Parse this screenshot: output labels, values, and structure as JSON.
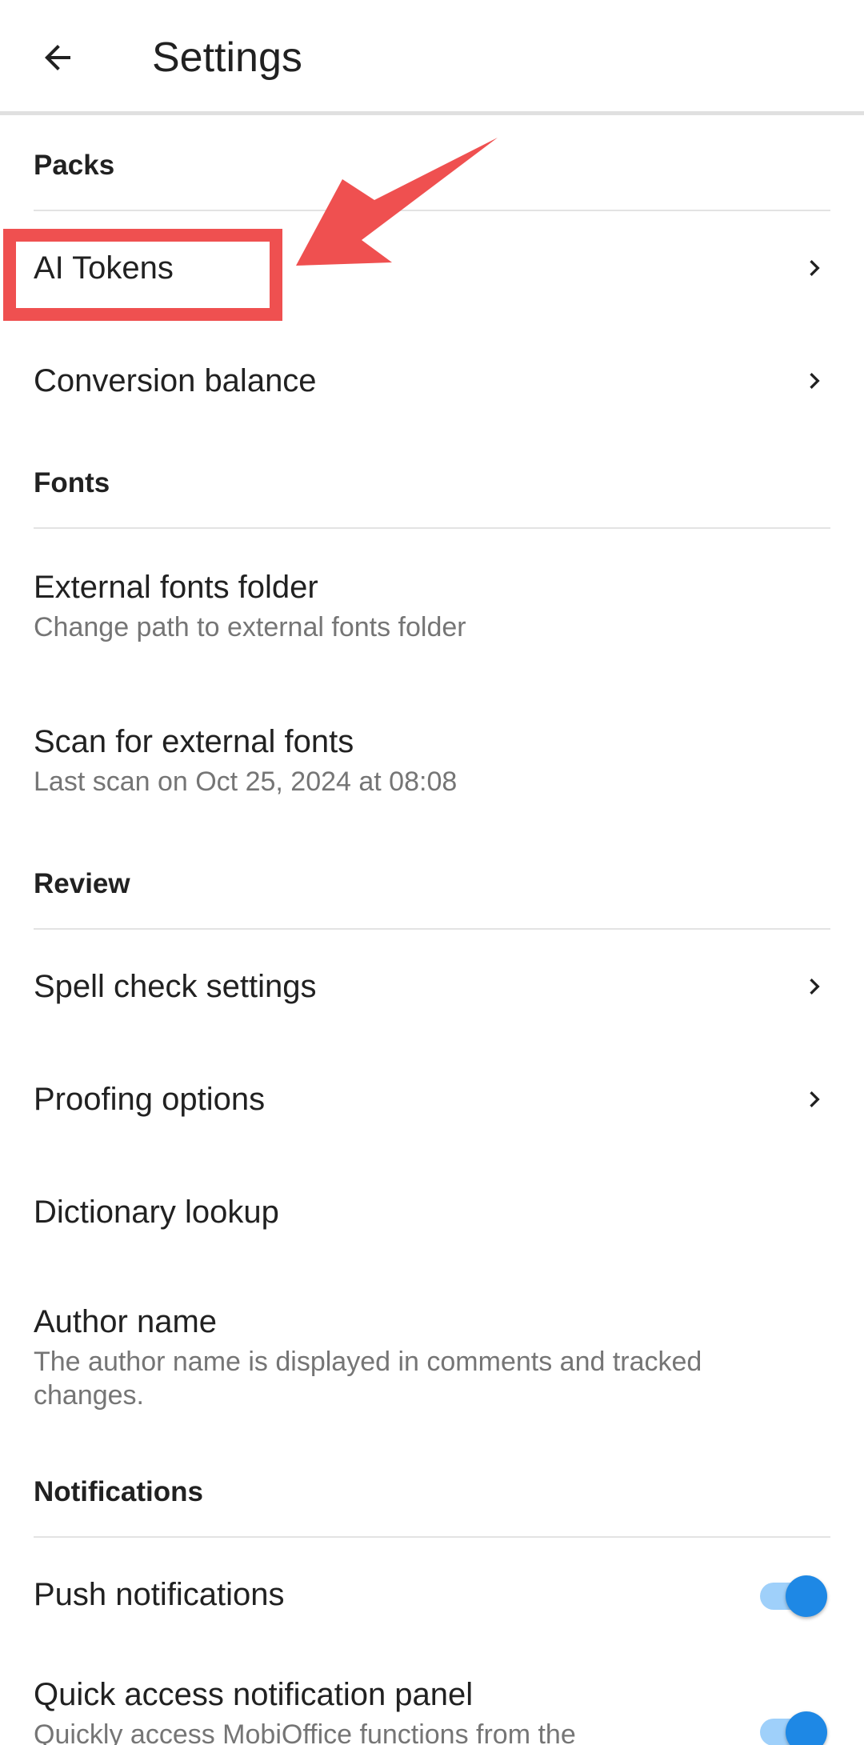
{
  "appbar": {
    "title": "Settings",
    "back_icon": "arrow-left-icon"
  },
  "sections": {
    "packs": {
      "header": "Packs",
      "ai_tokens": {
        "title": "AI Tokens"
      },
      "conversion_balance": {
        "title": "Conversion balance"
      }
    },
    "fonts": {
      "header": "Fonts",
      "external_folder": {
        "title": "External fonts folder",
        "subtitle": "Change path to external fonts folder"
      },
      "scan": {
        "title": "Scan for external fonts",
        "subtitle": "Last scan on Oct 25, 2024 at 08:08"
      }
    },
    "review": {
      "header": "Review",
      "spell_check": {
        "title": "Spell check settings"
      },
      "proofing": {
        "title": "Proofing options"
      },
      "dictionary": {
        "title": "Dictionary lookup"
      },
      "author": {
        "title": "Author name",
        "subtitle": "The author name is displayed in comments and tracked changes."
      }
    },
    "notifications": {
      "header": "Notifications",
      "push": {
        "title": "Push notifications",
        "enabled": true
      },
      "quick_access": {
        "title": "Quick access notification panel",
        "subtitle": "Quickly access MobiOffice functions from the",
        "enabled": true
      }
    }
  },
  "colors": {
    "annotation_red": "#ef5050",
    "toggle_thumb": "#1e88e5",
    "toggle_track": "#9fd0fa",
    "divider": "#e3e3e3"
  }
}
